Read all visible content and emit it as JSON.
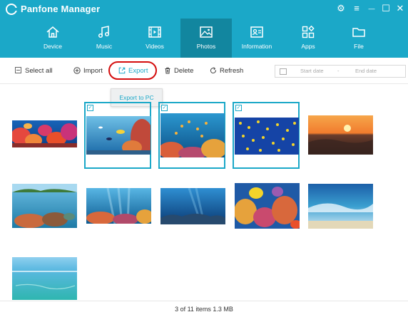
{
  "app": {
    "title": "Panfone Manager"
  },
  "window_controls": [
    {
      "name": "settings-icon",
      "glyph": "⚙"
    },
    {
      "name": "menu-icon",
      "glyph": "≡"
    },
    {
      "name": "minimize-icon",
      "glyph": "—"
    },
    {
      "name": "maximize-icon",
      "glyph": "☐"
    },
    {
      "name": "close-icon",
      "glyph": "✕"
    }
  ],
  "nav": {
    "items": [
      {
        "label": "Device",
        "icon": "home-icon"
      },
      {
        "label": "Music",
        "icon": "music-icon"
      },
      {
        "label": "Videos",
        "icon": "film-icon"
      },
      {
        "label": "Photos",
        "icon": "image-icon",
        "active": true
      },
      {
        "label": "Information",
        "icon": "contact-card-icon"
      },
      {
        "label": "Apps",
        "icon": "apps-icon"
      },
      {
        "label": "File",
        "icon": "folder-icon"
      }
    ]
  },
  "toolbar": {
    "select_all": "Select all",
    "import": "Import",
    "export": "Export",
    "delete": "Delete",
    "refresh": "Refresh",
    "start_date_placeholder": "Start date",
    "date_separator": "-",
    "end_date_placeholder": "End date"
  },
  "export_menu": {
    "items": [
      "Export to PC"
    ]
  },
  "photos": [
    {
      "scene": "coral-reef-wide",
      "selected": false
    },
    {
      "scene": "reef-fish-blue",
      "selected": true
    },
    {
      "scene": "coral-fish-school",
      "selected": true
    },
    {
      "scene": "yellow-fish-school",
      "selected": true
    },
    {
      "scene": "ocean-sunset",
      "selected": false
    },
    {
      "scene": "island-underwater-split",
      "selected": false
    },
    {
      "scene": "reef-sunrays",
      "selected": false
    },
    {
      "scene": "deep-blue-reef",
      "selected": false
    },
    {
      "scene": "colorful-coral",
      "selected": false
    },
    {
      "scene": "ocean-wave",
      "selected": false
    },
    {
      "scene": "tropical-shallows",
      "selected": false
    }
  ],
  "status": {
    "text": "3 of 11 items 1.3 MB"
  },
  "colors": {
    "accent": "#1ba8c8",
    "accent_dark": "#12869f",
    "highlight_ring": "#d40c0c"
  }
}
